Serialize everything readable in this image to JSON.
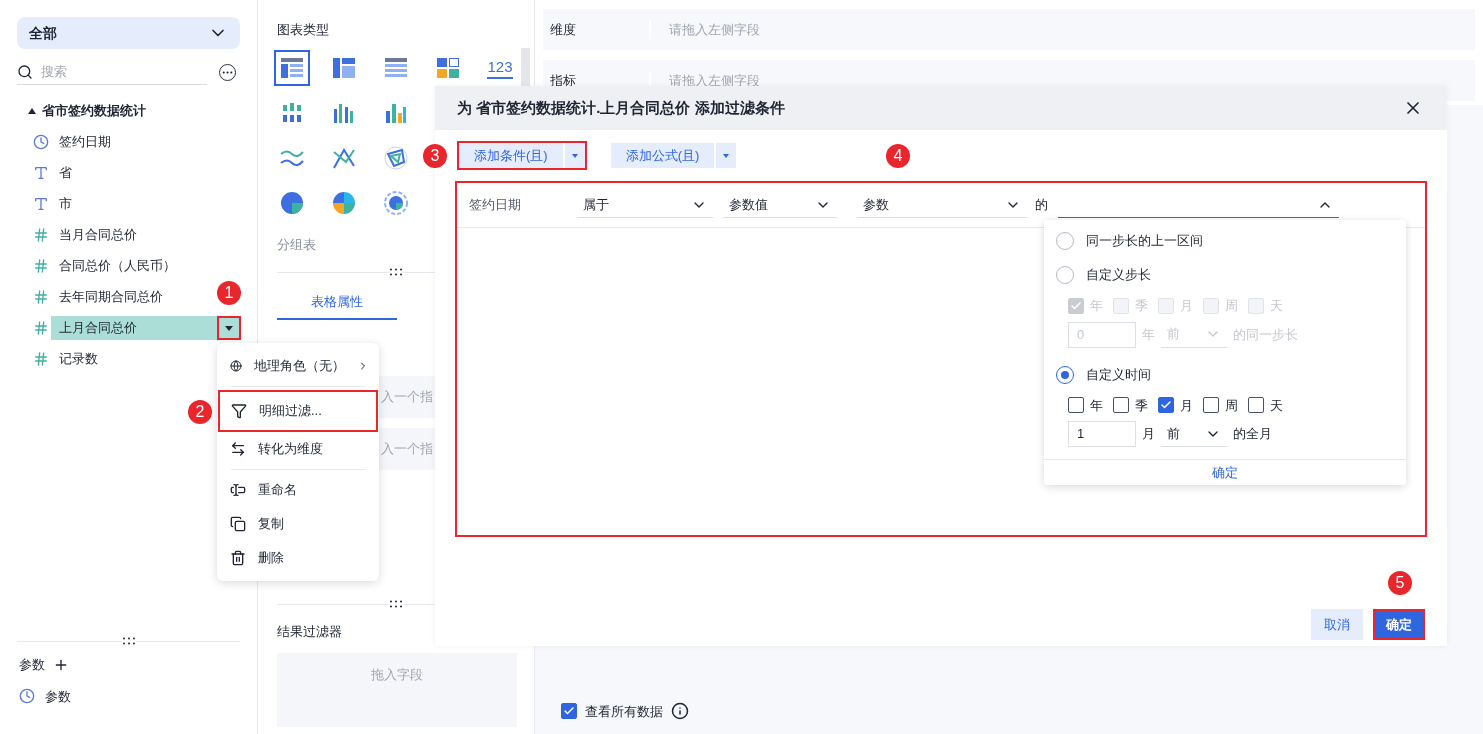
{
  "sidebar": {
    "scope": "全部",
    "search": {
      "placeholder": "搜索"
    },
    "dataset": {
      "name": "省市签约数据统计",
      "expanded": true,
      "fields": [
        {
          "kind": "date",
          "label": "签约日期",
          "selected": false,
          "highlighted": false
        },
        {
          "kind": "text",
          "label": "省",
          "selected": false,
          "highlighted": false
        },
        {
          "kind": "text",
          "label": "市",
          "selected": false,
          "highlighted": false
        },
        {
          "kind": "number",
          "label": "当月合同总价",
          "selected": false,
          "highlighted": false
        },
        {
          "kind": "number",
          "label": "合同总价（人民币）",
          "selected": false,
          "highlighted": false
        },
        {
          "kind": "number",
          "label": "去年同期合同总价",
          "selected": false,
          "highlighted": false
        },
        {
          "kind": "number",
          "label": "上月合同总价",
          "selected": true,
          "highlighted": true
        },
        {
          "kind": "count",
          "label": "记录数",
          "selected": false,
          "highlighted": false
        }
      ]
    },
    "params_title": "参数",
    "params": [
      "参数"
    ]
  },
  "middle": {
    "chart_type_title": "图表类型",
    "chart_type_rows": [
      [
        {
          "selected": true
        },
        {
          "selected": false
        },
        {
          "selected": false
        },
        {
          "selected": false
        },
        {
          "selected": false
        }
      ],
      [
        {
          "selected": false
        },
        {
          "selected": false
        },
        {
          "selected": false
        }
      ],
      [
        {
          "selected": false
        },
        {
          "selected": false
        },
        {
          "selected": false
        }
      ],
      [
        {
          "selected": false
        },
        {
          "selected": false
        },
        {
          "selected": false
        }
      ]
    ],
    "number_chart_label": "123",
    "chart_type_name": "分组表",
    "tabs": [
      {
        "label": "表格属性",
        "selected": true
      }
    ],
    "drop_zones": [
      "入一个指",
      "入一个指"
    ],
    "result_filter_title": "结果过滤器",
    "result_filter_placeholder": "拖入字段"
  },
  "shelf": [
    {
      "label": "维度",
      "placeholder": "请拖入左侧字段"
    },
    {
      "label": "指标",
      "placeholder": "请拖入左侧字段"
    }
  ],
  "view_all": {
    "label": "查看所有数据",
    "checked": true
  },
  "context_menu": [
    [
      {
        "label": "地理角色（无）",
        "submenu": true,
        "highlighted": false
      }
    ],
    [
      {
        "label": "明细过滤...",
        "submenu": false,
        "highlighted": true
      },
      {
        "label": "转化为维度",
        "submenu": false,
        "highlighted": false
      }
    ],
    [
      {
        "label": "重命名",
        "submenu": false,
        "highlighted": false
      },
      {
        "label": "复制",
        "submenu": false,
        "highlighted": false
      },
      {
        "label": "删除",
        "submenu": false,
        "highlighted": false
      }
    ]
  ],
  "dialog": {
    "title": "为 省市签约数据统计.上月合同总价 添加过滤条件",
    "add_buttons": [
      {
        "label": "添加条件(且)",
        "highlighted": true
      },
      {
        "label": "添加公式(且)",
        "highlighted": false
      }
    ],
    "condition": {
      "highlighted": true,
      "field": "签约日期",
      "selects": [
        "属于",
        "参数值",
        "参数"
      ],
      "of_label": "的",
      "open_select_expanded": true
    },
    "popup": {
      "options": [
        {
          "label": "同一步长的上一区间",
          "selected": false
        },
        {
          "label": "自定义步长",
          "selected": false,
          "disabled": true,
          "units": [
            {
              "label": "年",
              "checked": true
            },
            {
              "label": "季",
              "checked": false
            },
            {
              "label": "月",
              "checked": false
            },
            {
              "label": "周",
              "checked": false
            },
            {
              "label": "天",
              "checked": false
            }
          ],
          "value": "0",
          "unit": "年",
          "direction": "前",
          "suffix": "的同一步长"
        },
        {
          "label": "自定义时间",
          "selected": true,
          "disabled": false,
          "units": [
            {
              "label": "年",
              "checked": false
            },
            {
              "label": "季",
              "checked": false
            },
            {
              "label": "月",
              "checked": true
            },
            {
              "label": "周",
              "checked": false
            },
            {
              "label": "天",
              "checked": false
            }
          ],
          "value": "1",
          "unit": "月",
          "direction": "前",
          "suffix": "的全月"
        }
      ],
      "confirm": "确定"
    },
    "buttons": [
      {
        "label": "取消",
        "kind": "secondary",
        "highlighted": false
      },
      {
        "label": "确定",
        "kind": "primary",
        "highlighted": true
      }
    ]
  },
  "annotations": [
    "1",
    "2",
    "3",
    "4",
    "5"
  ]
}
